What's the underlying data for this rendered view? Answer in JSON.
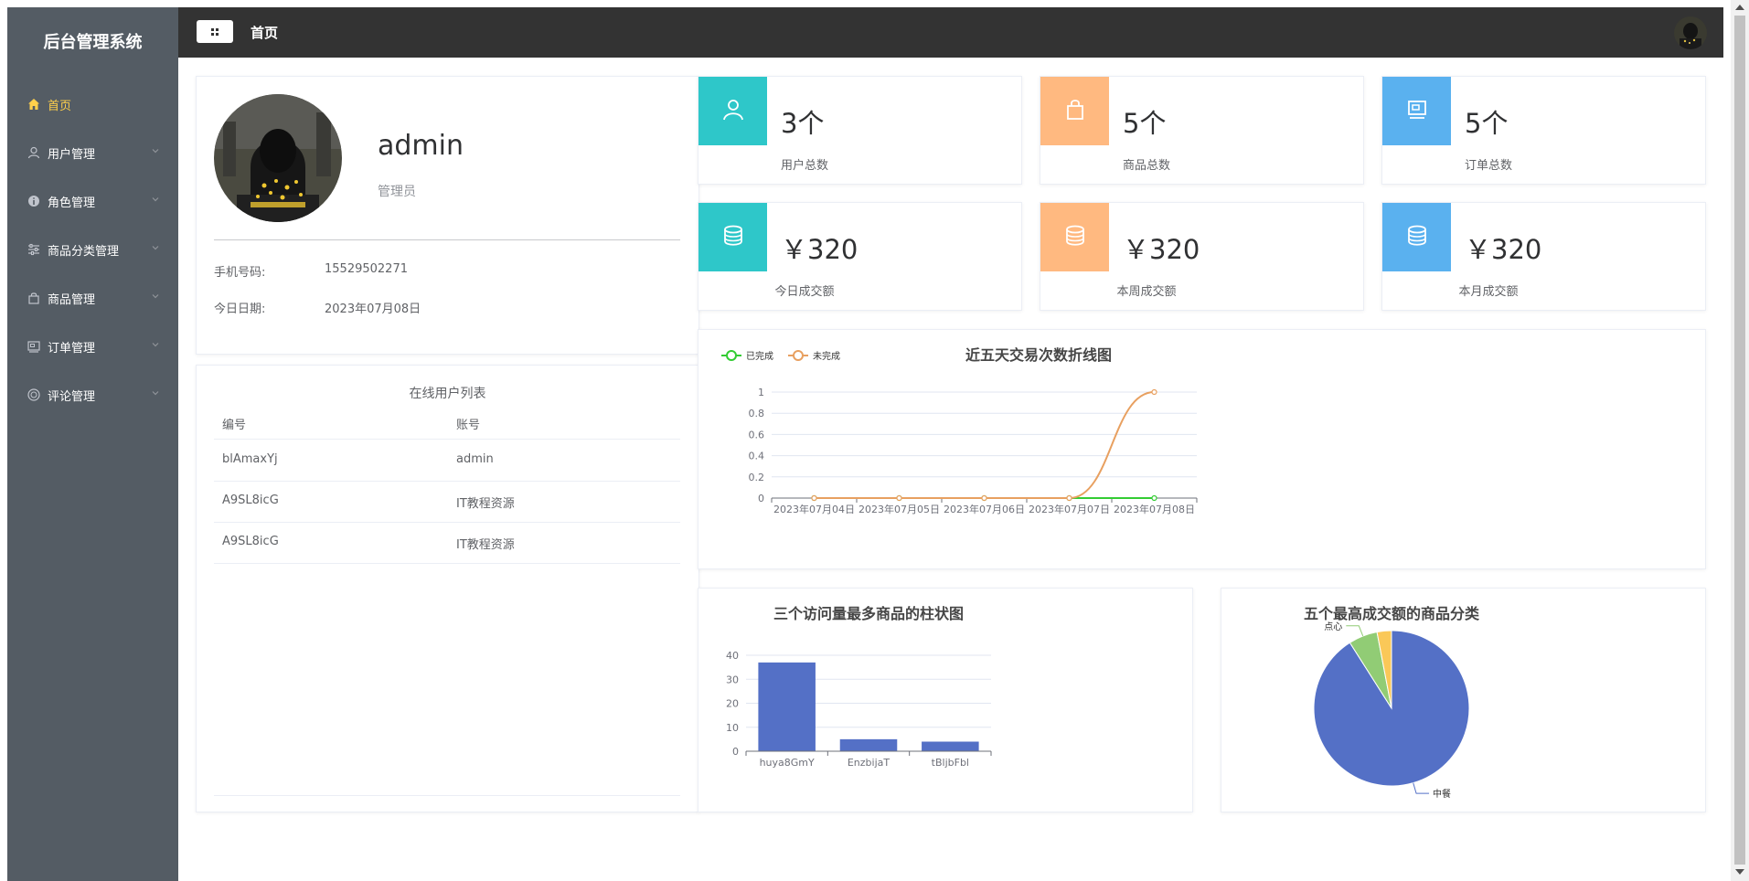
{
  "sidebar": {
    "title": "后台管理系统",
    "items": [
      {
        "label": "首页",
        "icon": "home-icon",
        "active": true
      },
      {
        "label": "用户管理",
        "icon": "user-icon"
      },
      {
        "label": "角色管理",
        "icon": "info-icon"
      },
      {
        "label": "商品分类管理",
        "icon": "sliders-icon"
      },
      {
        "label": "商品管理",
        "icon": "shopping-bag-icon"
      },
      {
        "label": "订单管理",
        "icon": "tickets-icon"
      },
      {
        "label": "评论管理",
        "icon": "chat-icon"
      }
    ]
  },
  "header": {
    "breadcrumb": "首页"
  },
  "profile": {
    "name": "admin",
    "role": "管理员",
    "phone_label": "手机号码:",
    "phone": "15529502271",
    "date_label": "今日日期:",
    "date": "2023年07月08日"
  },
  "online_users": {
    "title": "在线用户列表",
    "columns": [
      "编号",
      "账号"
    ],
    "rows": [
      [
        "blAmaxYj",
        "admin"
      ],
      [
        "A9SL8icG",
        "IT教程资源"
      ],
      [
        "A9SL8icG",
        "IT教程资源"
      ]
    ]
  },
  "stats": [
    {
      "value": "3个",
      "label": "用户总数",
      "color": "#2ec7c9",
      "icon": "user-icon"
    },
    {
      "value": "5个",
      "label": "商品总数",
      "color": "#ffb980",
      "icon": "shopping-bag-icon"
    },
    {
      "value": "5个",
      "label": "订单总数",
      "color": "#5ab1ef",
      "icon": "tickets-icon"
    },
    {
      "value": "￥320",
      "label": "今日成交额",
      "color": "#2ec7c9",
      "icon": "coins-icon"
    },
    {
      "value": "￥320",
      "label": "本周成交额",
      "color": "#ffb980",
      "icon": "coins-icon"
    },
    {
      "value": "￥320",
      "label": "本月成交额",
      "color": "#5ab1ef",
      "icon": "coins-icon"
    }
  ],
  "chart_data": [
    {
      "type": "line",
      "title": "近五天交易次数折线图",
      "x": [
        "2023年07月04日",
        "2023年07月05日",
        "2023年07月06日",
        "2023年07月07日",
        "2023年07月08日"
      ],
      "ylim": [
        0,
        1
      ],
      "yticks": [
        0,
        0.2,
        0.4,
        0.6,
        0.8,
        1
      ],
      "series": [
        {
          "name": "已完成",
          "values": [
            0,
            0,
            0,
            0,
            0
          ],
          "color": "#33cc33"
        },
        {
          "name": "未完成",
          "values": [
            0,
            0,
            0,
            0,
            1
          ],
          "color": "#e8a060"
        }
      ],
      "legend": "top-left",
      "grid": true
    },
    {
      "type": "bar",
      "title": "三个访问量最多商品的柱状图",
      "categories": [
        "huya8GmY",
        "EnzbijaT",
        "tBljbFbl"
      ],
      "values": [
        37,
        5,
        4
      ],
      "ylim": [
        0,
        40
      ],
      "yticks": [
        0,
        10,
        20,
        30,
        40
      ],
      "color": "#5470c6",
      "grid": true
    },
    {
      "type": "pie",
      "title": "五个最高成交额的商品分类",
      "slices": [
        {
          "name": "中餐",
          "value": 91,
          "color": "#5470c6"
        },
        {
          "name": "点心",
          "value": 6,
          "color": "#91cc75"
        },
        {
          "name": "",
          "value": 3,
          "color": "#fac858"
        }
      ]
    }
  ]
}
